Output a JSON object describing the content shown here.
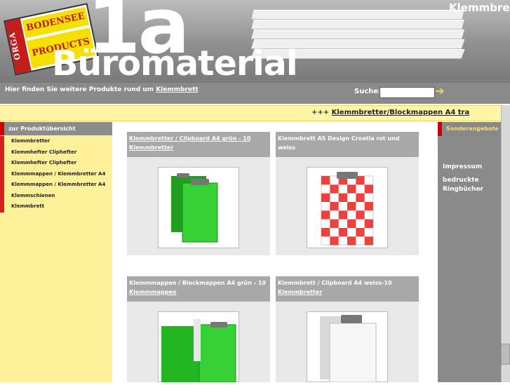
{
  "header": {
    "title_1a": "1a",
    "title_word": "Büromaterial",
    "top_right_text": "Klemmbre",
    "logo": {
      "orga": "ORGA",
      "line1": "BODENSEE",
      "line2": "PRODUCTS"
    }
  },
  "subbar": {
    "info_prefix": "Hier finden Sie weitere Produkte rund um",
    "info_link": "Klemmbrett",
    "search_label": "Suche:",
    "search_value": "",
    "go_icon": "arrow-right-icon"
  },
  "ticker": {
    "prefix": "+++",
    "link": "Klemmbretter/Blockmappen A4 tra"
  },
  "sidebar": {
    "heading": "zur Produktübersicht",
    "items": [
      {
        "label": "Klemmbretter"
      },
      {
        "label": "Klemmhefter Cliphefter"
      },
      {
        "label": "Klemmhefter Cliphefter"
      },
      {
        "label": "Klemmmappen / Klemmbretter A4"
      },
      {
        "label": "Klemmmappen / Klemmbretter A4"
      },
      {
        "label": "Klemmschienen"
      },
      {
        "label": "Klemmbrett"
      }
    ]
  },
  "products": [
    {
      "title": "Klemmbretter / Clipboard A4 grün - 10",
      "category": "Klemmbretter",
      "image": "green-clipboard"
    },
    {
      "title": "Klemmbrett A5 Design Croatia rot und weiss",
      "category": "",
      "image": "checkered-clipboard"
    },
    {
      "title": "Klemmmappen / Blockmappen A4 grün - 10",
      "category": "Klemmmappen",
      "image": "green-folder-clipboard"
    },
    {
      "title": "Klemmbrett / Clipboard A4 weiss-10",
      "category": "Klemmbretter",
      "image": "white-clipboard"
    }
  ],
  "right": {
    "heading": "Sonderangebote",
    "links": [
      "Impressum",
      "bedruckte Ringbücher"
    ]
  },
  "colors": {
    "accent_red": "#c00000",
    "yellow": "#fff199",
    "green": "#22c122"
  }
}
